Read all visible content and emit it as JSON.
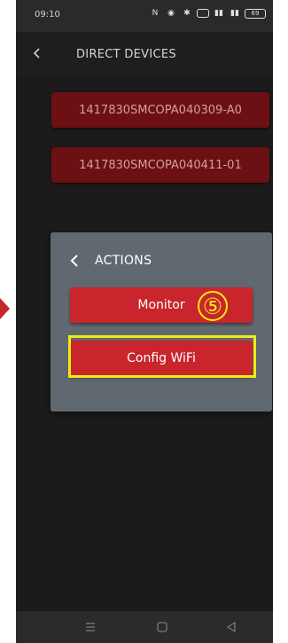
{
  "status": {
    "time": "09:10",
    "battery": "69"
  },
  "header": {
    "title": "DIRECT DEVICES"
  },
  "devices": [
    "1417830SMCOPA040309-A0",
    "1417830SMCOPA040411-01"
  ],
  "modal": {
    "title": "ACTIONS",
    "buttons": [
      "Monitor",
      "Config WiFi"
    ]
  },
  "annotation": {
    "step": "⑤",
    "highlight_color": "#f0ec13"
  },
  "icons": {
    "back": "chevron-left-icon",
    "nav": [
      "menu-icon",
      "home-icon",
      "back-triangle-icon"
    ]
  },
  "colors": {
    "button_red": "#c9252d",
    "device_red": "#6d1013",
    "modal_bg": "#606870"
  }
}
